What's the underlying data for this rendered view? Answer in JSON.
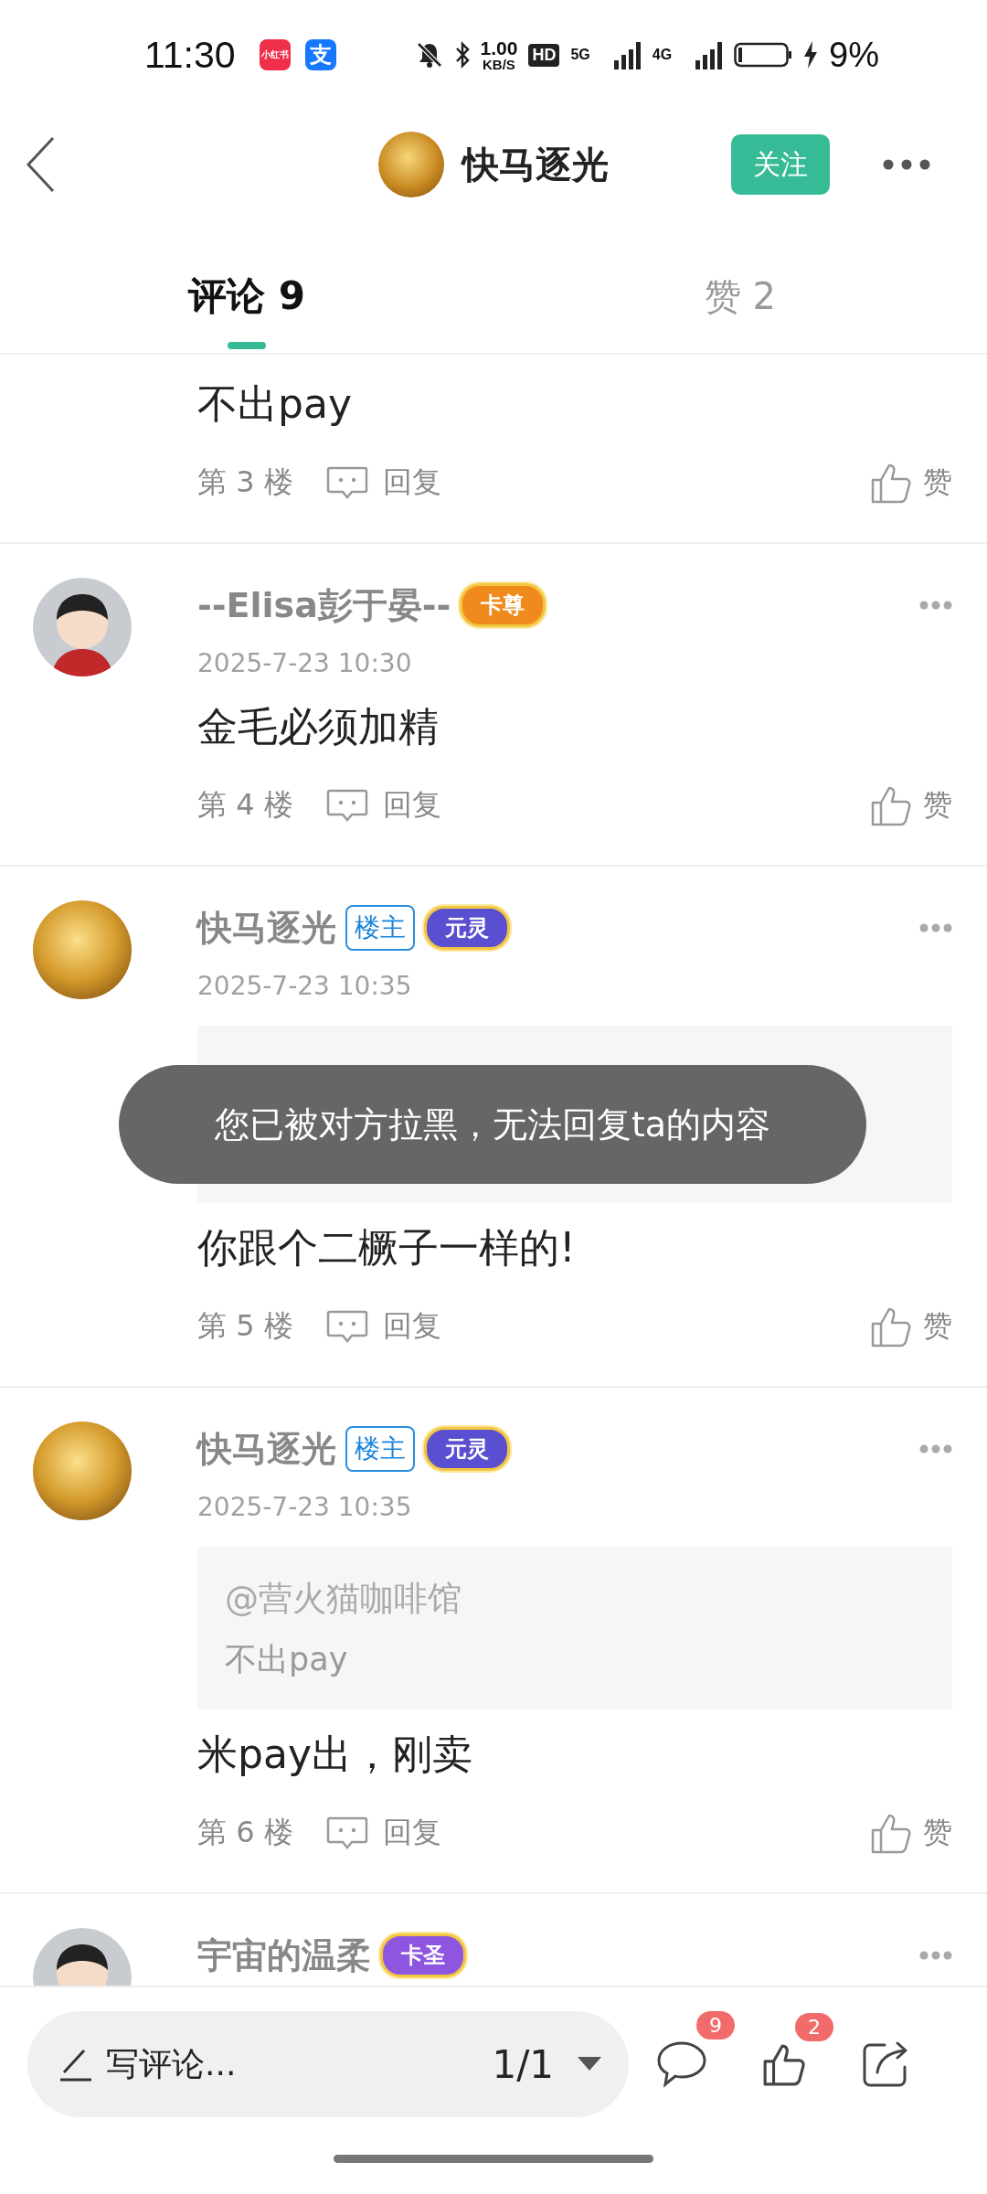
{
  "status_bar": {
    "time": "11:30",
    "notification_apps": [
      {
        "label": "小红书",
        "color": "#f0304a"
      },
      {
        "label": "支",
        "color": "#1677ff"
      }
    ],
    "network_speed": {
      "value": "1.00",
      "unit": "KB/S"
    },
    "hd_label": "HD",
    "network_5g": "5G",
    "network_4g": "4G",
    "battery_percent": "9%",
    "charging": true
  },
  "header": {
    "title": "快马逐光",
    "follow_button": "关注"
  },
  "tabs": [
    {
      "label": "评论 9",
      "selected": true
    },
    {
      "label": "赞 2",
      "selected": false
    }
  ],
  "comments": [
    {
      "text": "不出pay",
      "floor": "第 3 楼",
      "reply": "回复",
      "like": "赞"
    },
    {
      "avatar": {
        "kind": "cartoon"
      },
      "author": "--Elisa彭于晏--",
      "badges": [
        {
          "kind": "medal",
          "label": "卡尊",
          "color": "#f08a1c"
        }
      ],
      "date": "2025-7-23 10:30",
      "text": "金毛必须加精",
      "floor": "第 4 楼",
      "reply": "回复",
      "like": "赞"
    },
    {
      "avatar": {
        "kind": "photo"
      },
      "author": "快马逐光",
      "badges": [
        {
          "kind": "owner",
          "label": "楼主"
        },
        {
          "kind": "medal",
          "label": "元灵",
          "color": "#5a4fd0"
        }
      ],
      "date": "2025-7-23 10:35",
      "quote": {
        "kind": "covered"
      },
      "text": "你跟个二橛子一样的!",
      "floor": "第 5 楼",
      "reply": "回复",
      "like": "赞"
    },
    {
      "avatar": {
        "kind": "photo"
      },
      "author": "快马逐光",
      "badges": [
        {
          "kind": "owner",
          "label": "楼主"
        },
        {
          "kind": "medal",
          "label": "元灵",
          "color": "#5a4fd0"
        }
      ],
      "date": "2025-7-23 10:35",
      "quote": {
        "kind": "text",
        "mention": "@营火猫咖啡馆",
        "text": "不出pay"
      },
      "text": "米pay出，刚卖",
      "floor": "第 6 楼",
      "reply": "回复",
      "like": "赞"
    },
    {
      "avatar": {
        "kind": "cartoon"
      },
      "author": "宇宙的温柔",
      "badges": [
        {
          "kind": "medal",
          "label": "卡圣",
          "color": "#8e55e0"
        }
      ]
    }
  ],
  "toast": "您已被对方拉黑，无法回复ta的内容",
  "bottom_bar": {
    "compose_placeholder": "写评论...",
    "page": "1/1",
    "comment_count": "9",
    "like_count": "2"
  }
}
